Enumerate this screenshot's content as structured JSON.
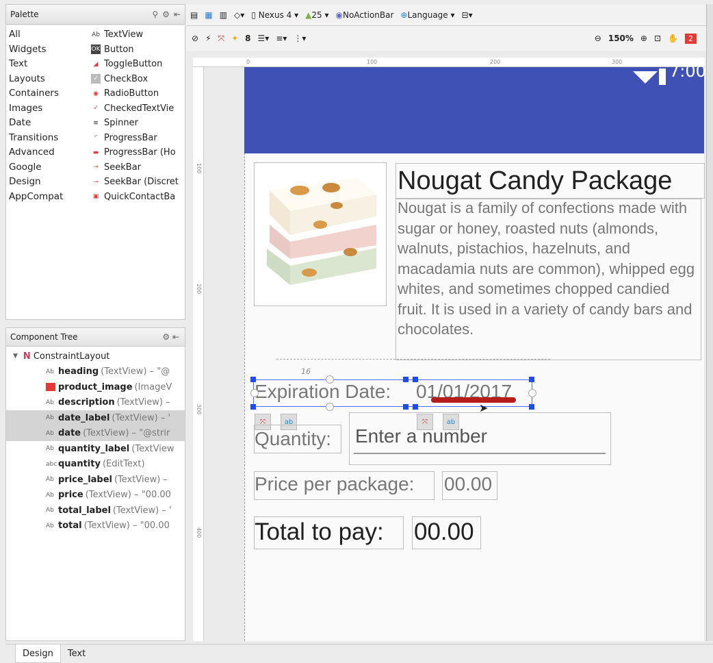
{
  "palette": {
    "title": "Palette",
    "categories": [
      "All",
      "Widgets",
      "Text",
      "Layouts",
      "Containers",
      "Images",
      "Date",
      "Transitions",
      "Advanced",
      "Google",
      "Design",
      "AppCompat"
    ],
    "items": [
      {
        "icon": "Ab",
        "label": "TextView"
      },
      {
        "icon": "OK",
        "label": "Button"
      },
      {
        "icon": "toggle",
        "label": "ToggleButton"
      },
      {
        "icon": "check",
        "label": "CheckBox"
      },
      {
        "icon": "radio",
        "label": "RadioButton"
      },
      {
        "icon": "checked",
        "label": "CheckedTextVie"
      },
      {
        "icon": "spinner",
        "label": "Spinner"
      },
      {
        "icon": "progress",
        "label": "ProgressBar"
      },
      {
        "icon": "hbar",
        "label": "ProgressBar (Ho"
      },
      {
        "icon": "seek",
        "label": "SeekBar"
      },
      {
        "icon": "seek",
        "label": "SeekBar (Discret"
      },
      {
        "icon": "contact",
        "label": "QuickContactBa"
      }
    ]
  },
  "tree": {
    "title": "Component Tree",
    "root": "ConstraintLayout",
    "rows": [
      {
        "icon": "Ab",
        "name": "heading",
        "rest": " (TextView) – \"@",
        "sel": false
      },
      {
        "icon": "img",
        "name": "product_image",
        "rest": " (ImageV",
        "sel": false
      },
      {
        "icon": "Ab",
        "name": "description",
        "rest": " (TextView) –",
        "sel": false
      },
      {
        "icon": "Ab",
        "name": "date_label",
        "rest": " (TextView) – '",
        "sel": true
      },
      {
        "icon": "Ab",
        "name": "date",
        "rest": " (TextView) – \"@strir",
        "sel": true
      },
      {
        "icon": "Ab",
        "name": "quantity_label",
        "rest": " (TextView",
        "sel": false
      },
      {
        "icon": "abc",
        "name": "quantity",
        "rest": " (EditText)",
        "sel": false
      },
      {
        "icon": "Ab",
        "name": "price_label",
        "rest": " (TextView) –",
        "sel": false
      },
      {
        "icon": "Ab",
        "name": "price",
        "rest": " (TextView) – \"00.00",
        "sel": false
      },
      {
        "icon": "Ab",
        "name": "total_label",
        "rest": " (TextView) – '",
        "sel": false
      },
      {
        "icon": "Ab",
        "name": "total",
        "rest": " (TextView) – \"00.00",
        "sel": false
      }
    ]
  },
  "toolbar": {
    "device": "Nexus 4",
    "api": "25",
    "theme": "NoActionBar",
    "language": "Language",
    "zoom": "150%",
    "margin": "8",
    "warnings": "2"
  },
  "rulers": {
    "h": [
      "0",
      "100",
      "200",
      "300"
    ],
    "v": [
      "100",
      "200",
      "300",
      "400"
    ]
  },
  "screen": {
    "clock": "7:00",
    "heading": "Nougat Candy Package",
    "description": "Nougat is a family of confections made with sugar or honey, roasted nuts (almonds, walnuts, pistachios, hazelnuts, and macadamia nuts are common), whipped egg whites, and sometimes chopped candied fruit. It is used in a variety of candy bars and chocolates.",
    "date_label": "Expiration Date:",
    "date": "01/01/2017",
    "quantity_label": "Quantity:",
    "quantity_placeholder": "Enter a number",
    "price_label": "Price per package:",
    "price": "00.00",
    "total_label": "Total to pay:",
    "total": "00.00",
    "margin_marker": "16"
  },
  "tabs": [
    "Design",
    "Text"
  ]
}
